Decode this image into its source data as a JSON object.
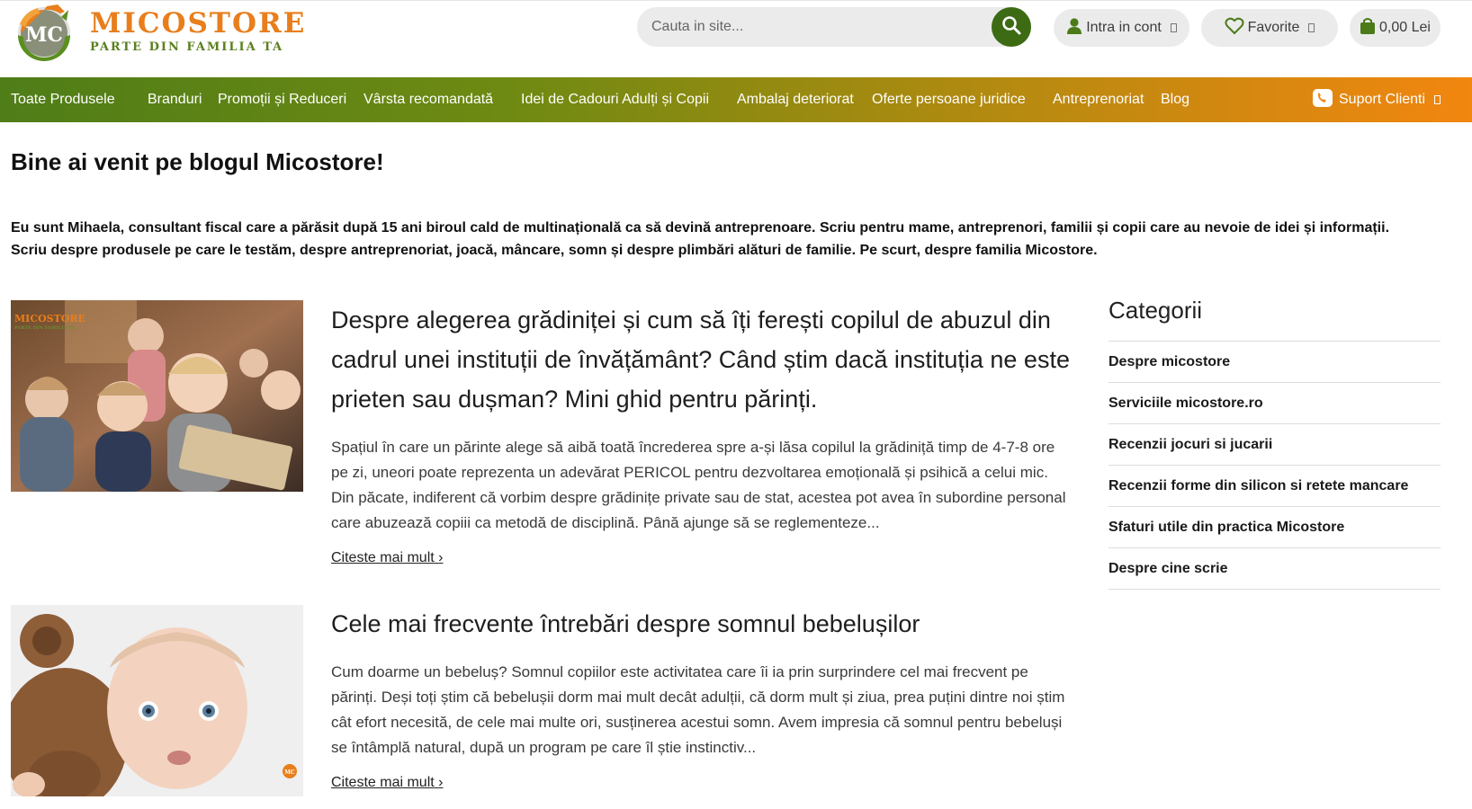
{
  "header": {
    "logo_title": "MICOSTORE",
    "logo_subtitle": "PARTE DIN FAMILIA TA",
    "logo_mark_text": "MC",
    "search_placeholder": "Cauta in site...",
    "account_label": "Intra in cont",
    "favorites_label": "Favorite",
    "cart_label": "0,00 Lei"
  },
  "nav": {
    "items": [
      "Toate Produsele",
      "Branduri",
      "Promoții și Reduceri",
      "Vârsta recomandată",
      "Idei de Cadouri Adulți și Copii",
      "Ambalaj deteriorat",
      "Oferte persoane juridice",
      "Antreprenoriat",
      "Blog"
    ],
    "support_label": "Suport Clienti"
  },
  "main": {
    "title": "Bine ai venit pe blogul Micostore!",
    "intro_line1": "Eu sunt Mihaela, consultant fiscal care a părăsit după 15 ani biroul cald de multinațională ca să devină antreprenoare. Scriu pentru mame, antreprenori, familii și copii care au nevoie de idei și informații.",
    "intro_line2": "Scriu despre produsele pe care le testăm, despre antreprenoriat, joacă, mâncare, somn și despre plimbări alături de familie. Pe scurt, despre familia Micostore."
  },
  "posts": [
    {
      "title": "Despre alegerea grădiniței și cum să îți ferești copilul de abuzul din cadrul unei instituții de învățământ? Când știm dacă instituția ne este prieten sau dușman? Mini ghid pentru părinți.",
      "excerpt": "Spațiul în care un părinte alege să aibă toată încrederea spre a-și lăsa copilul la grădiniță timp de 4-7-8 ore pe zi, uneori poate reprezenta un adevărat PERICOL pentru dezvoltarea emoțională și psihică a celui mic. Din păcate, indiferent că vorbim despre grădinițe private sau de stat, acestea pot avea în subordine personal care abuzează copiii ca metodă de disciplină. Până ajunge să se reglementeze...",
      "read_more": "Citeste mai mult",
      "image_watermark": "MICOSTORE",
      "image_watermark_sub": "PARTE DIN FAMILIA TA"
    },
    {
      "title": "Cele mai frecvente întrebări despre somnul bebelușilor",
      "excerpt": "Cum doarme un bebeluș? Somnul copiilor este activitatea care îi ia prin surprindere cel mai frecvent pe părinți. Deși toți știm că bebelușii dorm mai mult decât adulții, că dorm mult și ziua, prea puțini dintre noi știm cât efort necesită, de cele mai multe ori, susținerea acestui somn. Avem impresia că somnul pentru bebeluși se întâmplă natural, după un program pe care îl știe instinctiv...",
      "read_more": "Citeste mai mult"
    }
  ],
  "sidebar": {
    "title": "Categorii",
    "categories": [
      "Despre micostore",
      "Serviciile micostore.ro",
      "Recenzii jocuri si jucarii",
      "Recenzii forme din silicon si retete mancare",
      "Sfaturi utile din practica Micostore",
      "Despre cine scrie"
    ]
  },
  "colors": {
    "brand_orange": "#e87e1c",
    "brand_green": "#4f7d18",
    "search_button": "#3d6b14"
  },
  "icons": {
    "search": "search-icon",
    "account": "user-icon",
    "favorites": "heart-icon",
    "cart": "shopping-bag-icon",
    "support": "phone-icon",
    "read_more": "chevron-right-icon"
  }
}
